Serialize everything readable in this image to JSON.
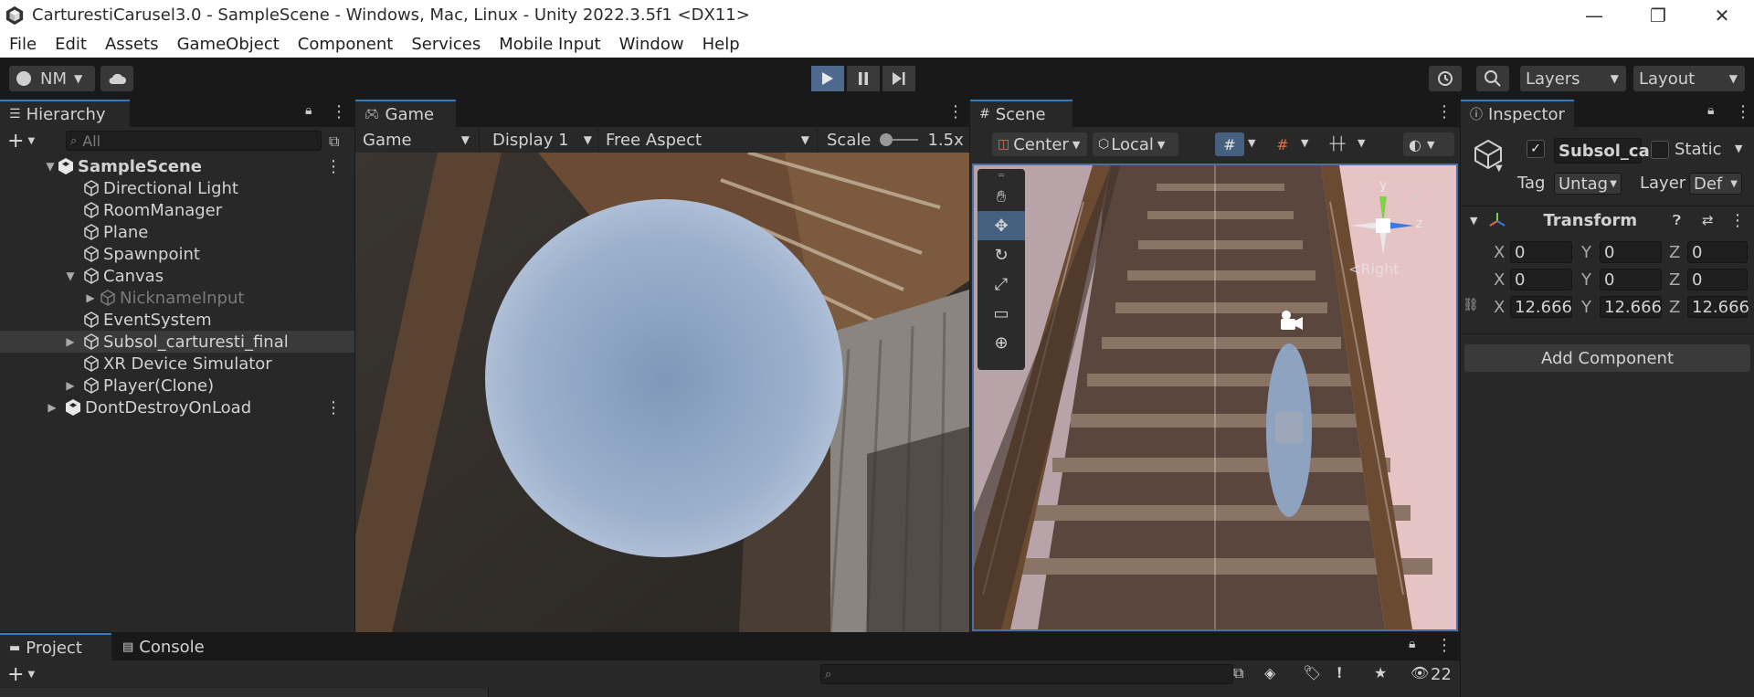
{
  "window": {
    "title": "CarturestiCarusel3.0 - SampleScene - Windows, Mac, Linux - Unity 2022.3.5f1 <DX11>",
    "controls": [
      "—",
      "❐",
      "✕"
    ]
  },
  "menu": [
    "File",
    "Edit",
    "Assets",
    "GameObject",
    "Component",
    "Services",
    "Mobile Input",
    "Window",
    "Help"
  ],
  "toolbar": {
    "account": "NM",
    "layers_label": "Layers",
    "layout_label": "Layout"
  },
  "hierarchy": {
    "tab": "Hierarchy",
    "search_placeholder": "All",
    "scene_name": "SampleScene",
    "items": [
      {
        "label": "Directional Light"
      },
      {
        "label": "RoomManager"
      },
      {
        "label": "Plane"
      },
      {
        "label": "Spawnpoint"
      },
      {
        "label": "Canvas"
      },
      {
        "label": "NicknameInput"
      },
      {
        "label": "EventSystem"
      },
      {
        "label": "Subsol_carturesti_final"
      },
      {
        "label": "XR Device Simulator"
      },
      {
        "label": "Player(Clone)"
      }
    ],
    "dont_destroy": "DontDestroyOnLoad"
  },
  "game": {
    "tab": "Game",
    "mode": "Game",
    "display": "Display 1",
    "aspect": "Free Aspect",
    "scale_label": "Scale",
    "scale_value": "1.5x"
  },
  "scene": {
    "tab": "Scene",
    "pivot": "Center",
    "space": "Local",
    "gizmo_y": "y",
    "gizmo_z": "z",
    "gizmo_view": "<Right"
  },
  "inspector": {
    "tab": "Inspector",
    "object_name": "Subsol_ca",
    "static_label": "Static",
    "tag_label": "Tag",
    "tag_value": "Untag",
    "layer_label": "Layer",
    "layer_value": "Def",
    "transform_label": "Transform",
    "rows": [
      {
        "x": "0",
        "y": "0",
        "z": "0"
      },
      {
        "x": "0",
        "y": "0",
        "z": "0"
      },
      {
        "x": "12.666",
        "y": "12.666",
        "z": "12.666"
      }
    ],
    "axis_x": "X",
    "axis_y": "Y",
    "axis_z": "Z",
    "add_component": "Add Component"
  },
  "bottom": {
    "tab_project": "Project",
    "tab_console": "Console",
    "hidden_count": "22"
  }
}
